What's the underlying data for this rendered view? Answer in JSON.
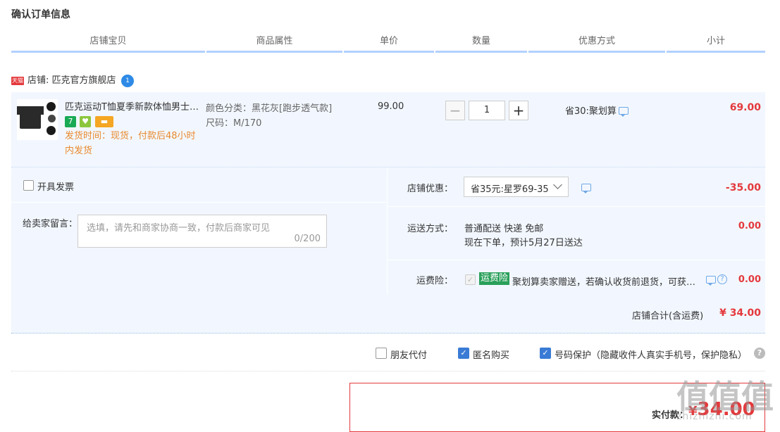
{
  "page_title": "确认订单信息",
  "columns": [
    "店铺宝贝",
    "商品属性",
    "单价",
    "数量",
    "优惠方式",
    "小计"
  ],
  "shop": {
    "badge": "天猫",
    "label": "店铺: 匹克官方旗舰店",
    "ww_badge": "1"
  },
  "item": {
    "name": "匹克运动T恤夏季新款体恤男士…",
    "badge_icons": [
      {
        "name": "seven-day-return-icon",
        "text": "7",
        "color": "#1aaa55"
      },
      {
        "name": "guarantee-icon",
        "text": "♥",
        "color": "#8cc63f"
      },
      {
        "name": "card-pay-icon",
        "text": "▬",
        "color": "#f5a623"
      }
    ],
    "ship_time": "发货时间：现货，付款后48小时内发货",
    "attr_color": "颜色分类：黑花灰[跑步透气款]",
    "attr_size": "尺码：M/170",
    "price": "99.00",
    "qty_minus": "−",
    "qty": "1",
    "qty_plus": "+",
    "promo": "省30:聚划算",
    "subtotal": "69.00"
  },
  "invoice_label": "开具发票",
  "memo": {
    "label": "给卖家留言：",
    "placeholder": "选填，请先和商家协商一致，付款后商家可见",
    "counter": "0/200"
  },
  "store_discount": {
    "label": "店铺优惠：",
    "selected": "省35元:星罗69-35",
    "value": "-35.00"
  },
  "shipping": {
    "label": "运送方式：",
    "method": "普通配送 快递 免邮",
    "eta": "现在下单，预计5月27日送达",
    "value": "0.00"
  },
  "insurance": {
    "label": "运费险：",
    "check": "✓",
    "tag": "运费险",
    "desc": "聚划算卖家赠送，若确认收货前退货，可获…",
    "help": "?",
    "value": "0.00"
  },
  "store_total": {
    "label": "店铺合计(含运费)",
    "value": "¥ 34.00"
  },
  "options": {
    "friend_pay": "朋友代付",
    "anonymous": "匿名购买",
    "anonymous_check": "✓",
    "number_protect": "号码保护（隐藏收件人真实手机号，保护隐私）",
    "number_protect_check": "✓",
    "help": "?"
  },
  "payment": {
    "label": "实付款：",
    "currency": "¥",
    "amount": "34.00"
  },
  "watermark": {
    "chars": [
      "值",
      "值",
      "值"
    ],
    "url": "zhizhizhi.com"
  },
  "colors": {
    "accent": "#3a7bd5",
    "price_red": "#e4393c",
    "panel_bg": "#f2f7ff",
    "ship_orange": "#e98a2e",
    "insurance_green": "#2aa05a"
  }
}
